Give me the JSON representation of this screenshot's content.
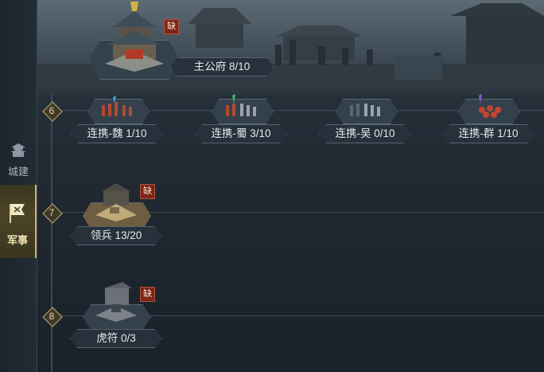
{
  "nav": {
    "city_label": "城建",
    "military_label": "军事"
  },
  "main_building": {
    "label": "主公府 8/10",
    "badge": "缺"
  },
  "tiers": [
    {
      "number": "6",
      "items": [
        {
          "label": "连携-魏 1/10"
        },
        {
          "label": "连携-蜀 3/10"
        },
        {
          "label": "连携-吴 0/10"
        },
        {
          "label": "连携-群 1/10"
        }
      ]
    },
    {
      "number": "7",
      "items": [
        {
          "label": "领兵 13/20",
          "badge": "缺"
        }
      ]
    },
    {
      "number": "8",
      "items": [
        {
          "label": "虎符 0/3",
          "badge": "缺"
        }
      ]
    }
  ],
  "colors": {
    "accent_gold": "#c4ae72",
    "badge_red": "#7a2619"
  }
}
